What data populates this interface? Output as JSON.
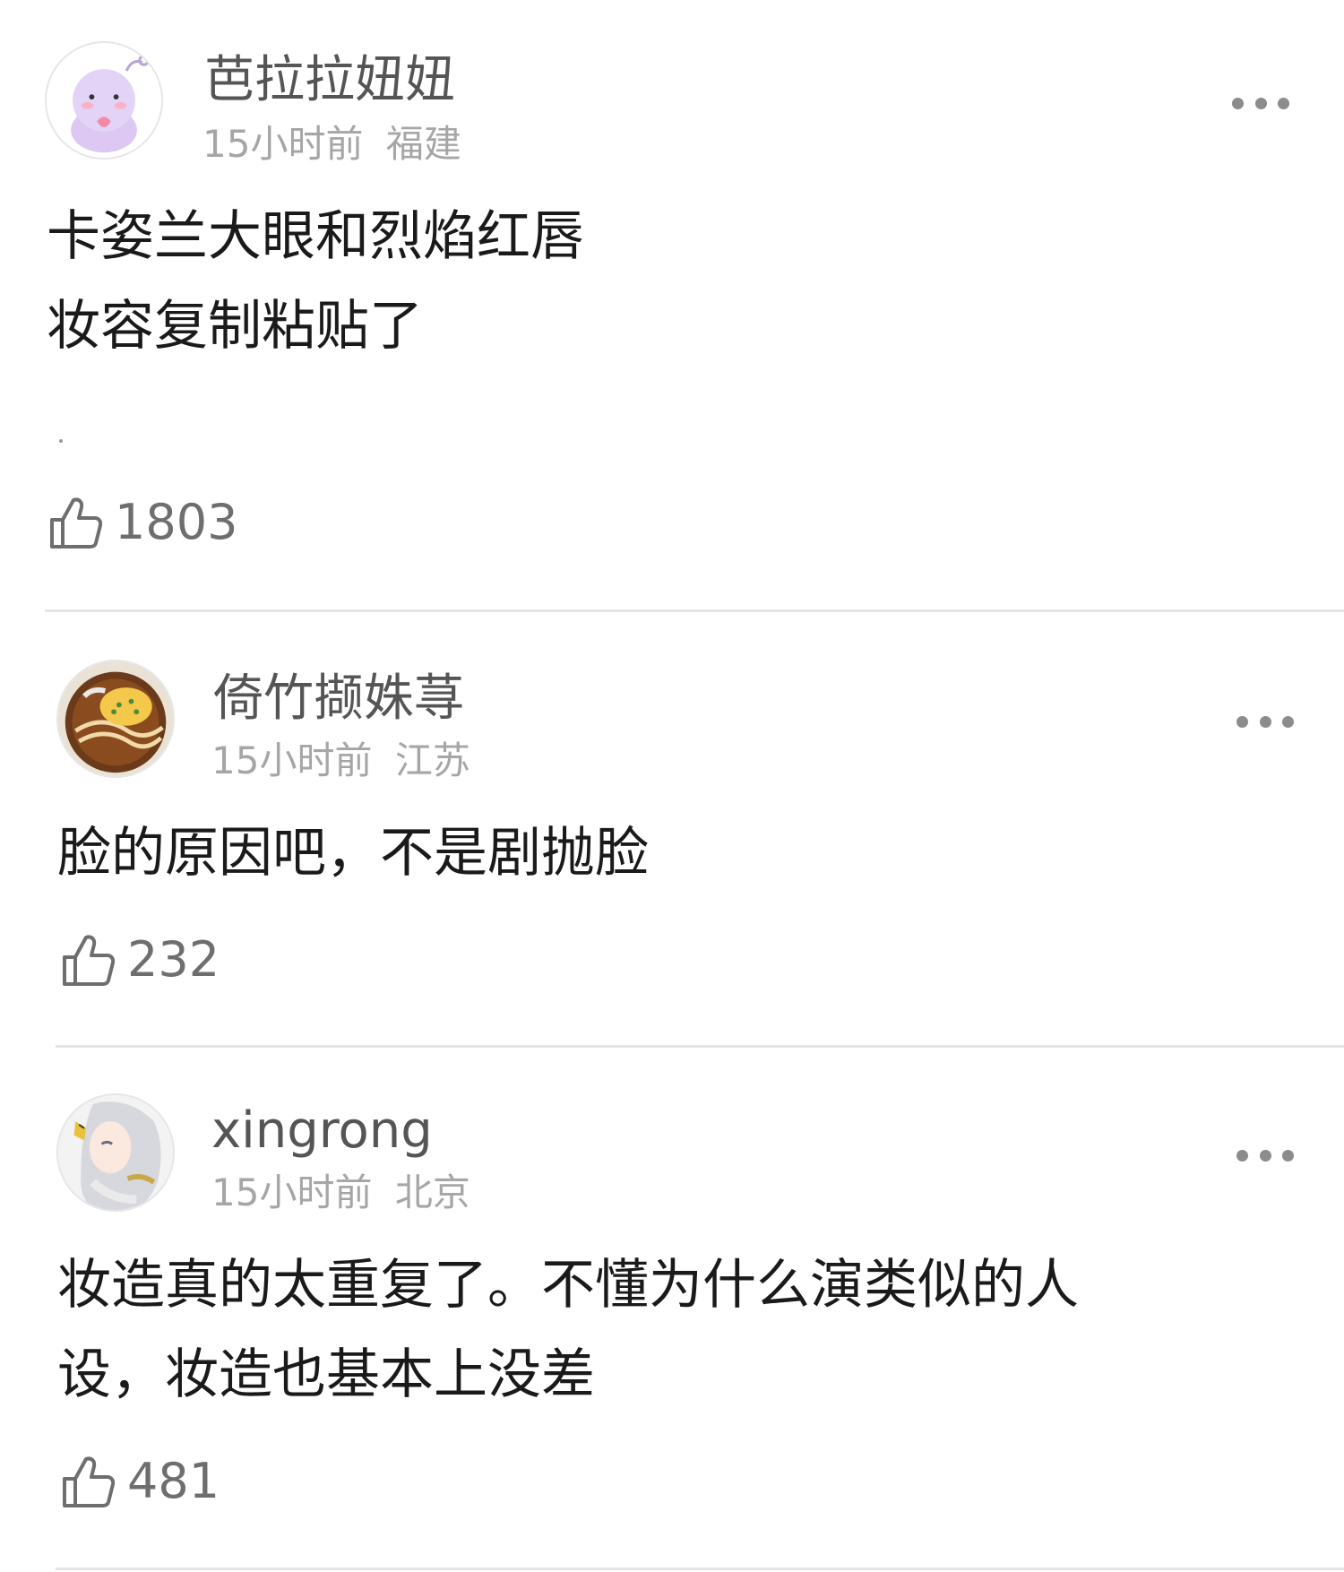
{
  "comments": [
    {
      "username": "芭拉拉妞妞",
      "time": "15小时前",
      "location": "福建",
      "lines": [
        "卡姿兰大眼和烈焰红唇",
        "妆容复制粘贴了"
      ],
      "likes": "1803",
      "avatar_icon": "purple-cartoon-avatar"
    },
    {
      "username": "倚竹撷姝荨",
      "time": "15小时前",
      "location": "江苏",
      "lines": [
        "脸的原因吧，不是剧抛脸"
      ],
      "likes": "232",
      "avatar_icon": "noodle-bowl-avatar"
    },
    {
      "username": "xingrong",
      "time": "15小时前",
      "location": "北京",
      "lines": [
        "妆造真的太重复了。不懂为什么演类似的人",
        "设，妆造也基本上没差"
      ],
      "likes": "481",
      "avatar_icon": "anime-character-avatar"
    }
  ],
  "colors": {
    "username": "#555555",
    "meta": "#a6a6a6",
    "text": "#1a1a1a",
    "likes": "#6e6e6e",
    "divider": "#e4e4e4"
  },
  "icons": {
    "like": "thumbs-up-icon",
    "more": "more-dots-icon"
  }
}
